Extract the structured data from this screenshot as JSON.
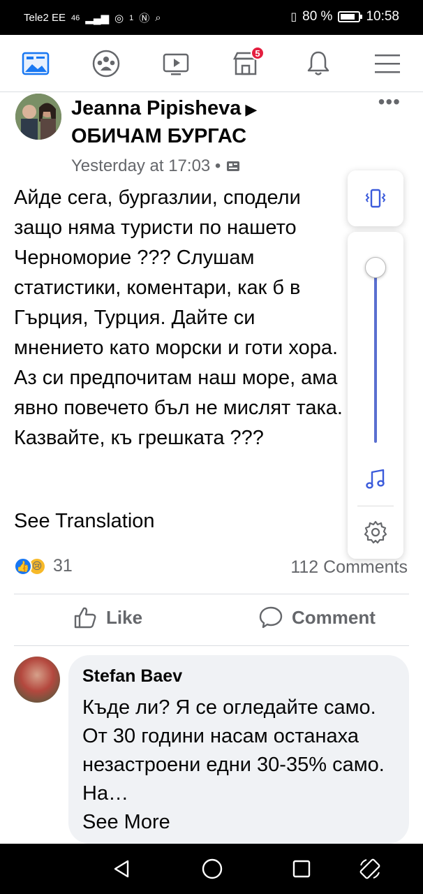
{
  "status_bar": {
    "carrier": "Tele2 EE",
    "network": "46",
    "sim": "1",
    "battery": "80 %",
    "time": "10:58"
  },
  "nav": {
    "notification_badge": "5"
  },
  "post": {
    "author": "Jeanna Pipisheva",
    "group": "ОБИЧАМ БУРГАС",
    "timestamp": "Yesterday at 17:03 •",
    "body": "Айде сега, бургазлии, сподели защо няма туристи по нашето Черноморие ??? Слушам статистики, коментари, как б в Гърция, Турция. Дайте си мнението като морски и готи хора. Аз си предпочитам наш море, ама явно повечето бъл не мислят така. Казвайте, къ грешката ???",
    "see_translation": "See Translation",
    "reaction_count": "31",
    "comments_count": "112 Comments",
    "like_label": "Like",
    "comment_label": "Comment"
  },
  "comment": {
    "author": "Stefan Baev",
    "text": "Къде ли? Я се огледайте само. От 30 години насам останаха незастроени едни 30-35% само. На…",
    "see_more": "See More"
  },
  "volume": {
    "level": 0.97
  },
  "colors": {
    "facebook_blue": "#1877f2",
    "volume_accent": "#5a6fd0",
    "badge_red": "#e41e3f"
  }
}
